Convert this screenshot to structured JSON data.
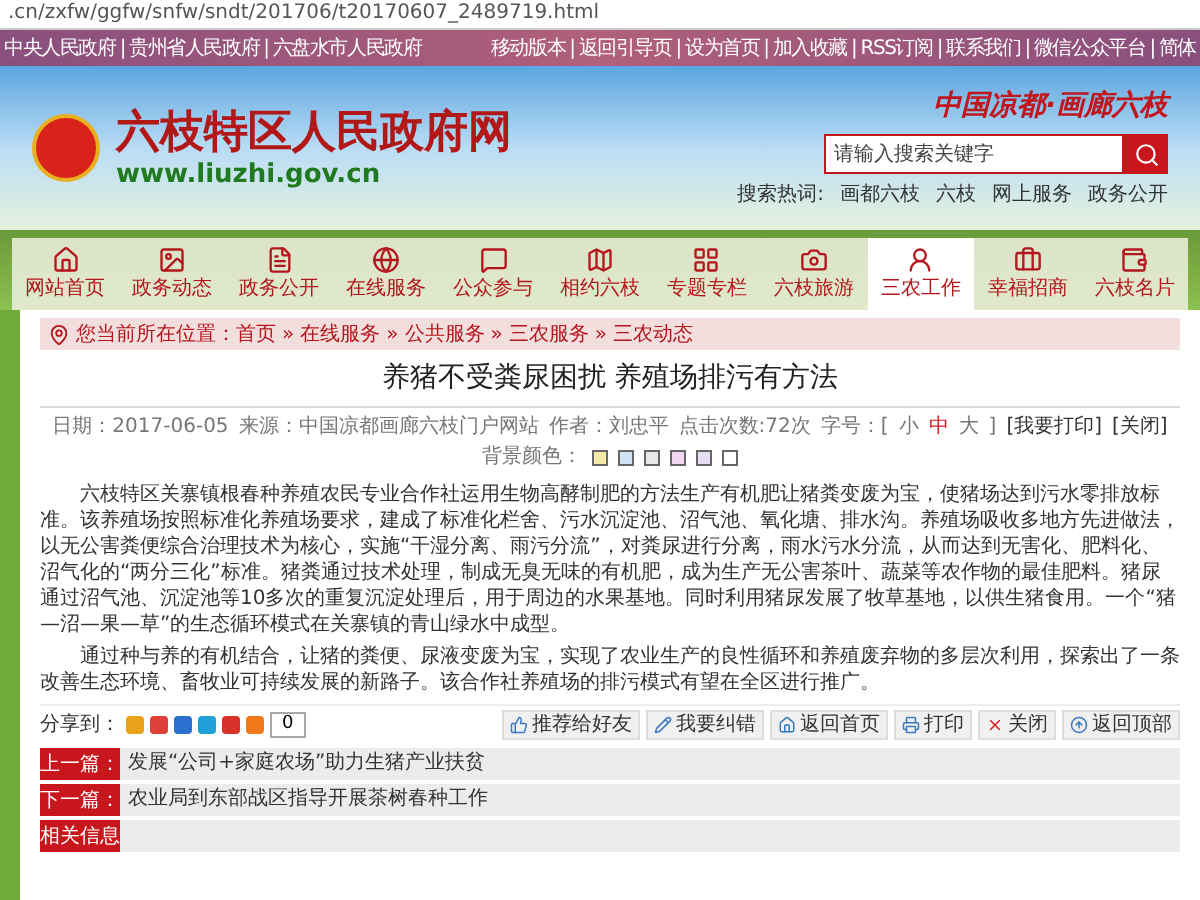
{
  "address_bar": {
    "url": ".cn/zxfw/ggfw/snfw/sndt/201706/t20170607_2489719.html"
  },
  "top_links_left": [
    "中央人民政府",
    "|",
    "贵州省人民政府",
    "|",
    "六盘水市人民政府"
  ],
  "top_links_right": [
    "移动版本",
    "|",
    "返回引导页",
    "|",
    "设为首页",
    "|",
    "加入收藏",
    "|",
    "RSS订阅",
    "|",
    "联系我们",
    "|",
    "微信公众平台",
    "|",
    "简体"
  ],
  "header": {
    "site_name": "六枝特区人民政府网",
    "site_url": "www.liuzhi.gov.cn",
    "slogan": "中国凉都·画廊六枝",
    "search": {
      "placeholder": "请输入搜索关键字"
    },
    "hot_label": "搜索热词:",
    "hot_words": [
      "画都六枝",
      "六枝",
      "网上服务",
      "政务公开"
    ]
  },
  "nav": [
    {
      "label": "网站首页",
      "selected": false
    },
    {
      "label": "政务动态",
      "selected": false
    },
    {
      "label": "政务公开",
      "selected": false
    },
    {
      "label": "在线服务",
      "selected": false
    },
    {
      "label": "公众参与",
      "selected": false
    },
    {
      "label": "相约六枝",
      "selected": false
    },
    {
      "label": "专题专栏",
      "selected": false
    },
    {
      "label": "六枝旅游",
      "selected": false
    },
    {
      "label": "三农工作",
      "selected": true
    },
    {
      "label": "幸福招商",
      "selected": false
    },
    {
      "label": "六枝名片",
      "selected": false
    }
  ],
  "breadcrumb": [
    "您当前所在位置：首页",
    "»",
    "在线服务",
    "»",
    "公共服务",
    "»",
    "三农服务",
    "»",
    "三农动态"
  ],
  "article": {
    "title": "养猪不受粪尿困扰 养殖场排污有方法",
    "meta": [
      "日期：2017-06-05",
      "来源：中国凉都画廊六枝门户网站",
      "作者：刘忠平",
      "点击次数:72次"
    ],
    "font_size_label": "字号：[",
    "font_sizes": [
      {
        "label": "小",
        "selected": false
      },
      {
        "label": "中",
        "selected": true
      },
      {
        "label": "大",
        "selected": false
      }
    ],
    "font_size_end": "]",
    "meta_links": [
      "[我要打印]",
      "[关闭]"
    ],
    "color_label": "背景颜色：",
    "colors": [
      {
        "color": "#f5e8a8"
      },
      {
        "color": "#cfe3f5"
      },
      {
        "color": "#e8e8e8"
      },
      {
        "color": "#f0d6ee"
      },
      {
        "color": "#e6def5"
      },
      {
        "color": "#ffffff"
      }
    ],
    "paragraphs": [
      "六枝特区关寨镇根春种养殖农民专业合作社运用生物高酵制肥的方法生产有机肥让猪粪变废为宝，使猪场达到污水零排放标准。该养殖场按照标准化养殖场要求，建成了标准化栏舍、污水沉淀池、沼气池、氧化塘、排水沟。养殖场吸收多地方先进做法，以无公害粪便综合治理技术为核心，实施“干湿分离、雨污分流”，对粪尿进行分离，雨水污水分流，从而达到无害化、肥料化、沼气化的“两分三化”标准。猪粪通过技术处理，制成无臭无味的有机肥，成为生产无公害茶叶、蔬菜等农作物的最佳肥料。猪尿通过沼气池、沉淀池等10多次的重复沉淀处理后，用于周边的水果基地。同时利用猪尿发展了牧草基地，以供生猪食用。一个“猪—沼—果—草”的生态循环模式在关寨镇的青山绿水中成型。",
      "通过种与养的有机结合，让猪的粪便、尿液变废为宝，实现了农业生产的良性循环和养殖废弃物的多层次利用，探索出了一条改善生态环境、畜牧业可持续发展的新路子。该合作社养殖场的排污模式有望在全区进行推广。"
    ]
  },
  "share": {
    "label": "分享到：",
    "count": "0"
  },
  "actions": [
    "推荐给好友",
    "我要纠错",
    "返回首页",
    "打印",
    "关闭",
    "返回顶部"
  ],
  "related": [
    {
      "label": "上一篇：",
      "text": "发展“公司+家庭农场”助力生猪产业扶贫"
    },
    {
      "label": "下一篇：",
      "text": "农业局到东部战区指导开展茶树春种工作"
    },
    {
      "label": "相关信息"
    }
  ]
}
